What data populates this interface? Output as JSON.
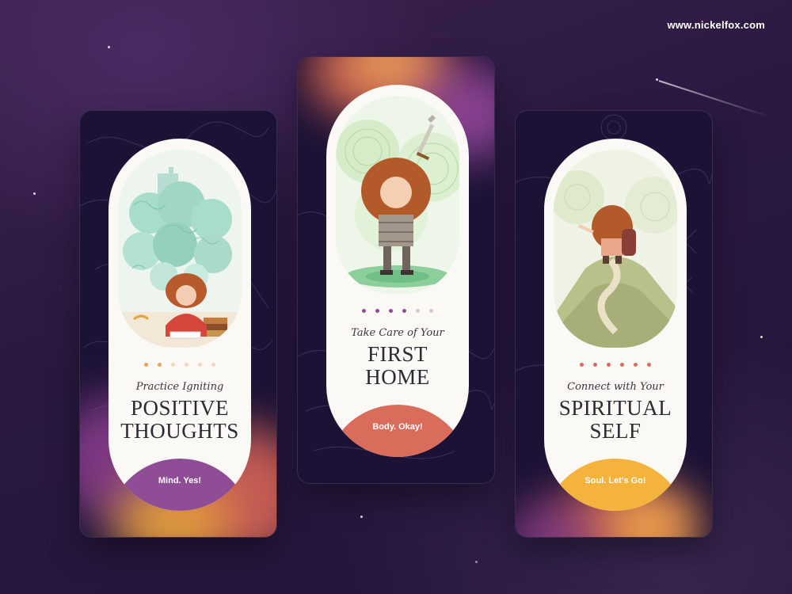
{
  "watermark": "www.nickelfox.com",
  "screens": [
    {
      "subtitle": "Practice Igniting",
      "title": "POSITIVE\nTHOUGHTS",
      "cta_label": "Mind. Yes!",
      "cta_color": "#8e4d94",
      "dot_color": "#e9a25c",
      "illustration": "daydreaming-girl-illustration"
    },
    {
      "subtitle": "Take Care of Your",
      "title": "FIRST\nHOME",
      "cta_label": "Body. Okay!",
      "cta_color": "#d96c5a",
      "dot_color": "#8e4d94",
      "illustration": "knight-girl-with-sword-illustration"
    },
    {
      "subtitle": "Connect with Your",
      "title": "SPIRITUAL\nSELF",
      "cta_label": "Soul. Let's Go!",
      "cta_color": "#f4b33c",
      "dot_color": "#d96c5a",
      "illustration": "hiker-girl-on-hill-illustration"
    }
  ],
  "pagination": {
    "total": 6,
    "active": [
      2,
      3,
      4
    ]
  }
}
